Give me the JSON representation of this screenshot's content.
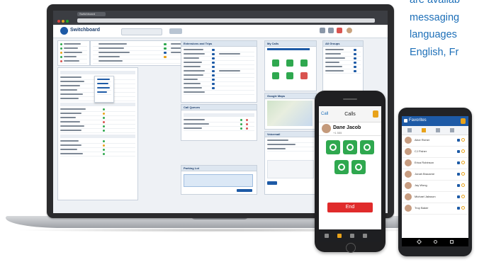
{
  "side_text": {
    "lines": [
      "are availab",
      "messaging",
      "languages",
      "English, Fr"
    ]
  },
  "laptop": {
    "browser_tab": "Switchboard",
    "app_title": "Switchboard",
    "panels": {
      "left_top": "",
      "middle_top": "Extensions and Trips",
      "middle_lower": "Call Queues",
      "middle_bottom": "Parking Lot",
      "right_top": "My Calls",
      "right_middle": "Google Maps",
      "right_lower": "Voicemail",
      "far_right": "All Groups"
    }
  },
  "ios_phone": {
    "back": "Call",
    "title": "Calls",
    "caller_name": "Dane Jacob",
    "caller_sub": "+1 555",
    "end_label": "End"
  },
  "android_phone": {
    "title": "Favorites",
    "contacts": [
      "Alice Richer",
      "CJ Fisher",
      "Erica Robinson",
      "Jonah Bracarne",
      "Jay Wong",
      "Michael Jaksson",
      "Troy Baker"
    ]
  },
  "colors": {
    "accent": "#1d6fb8",
    "brand": "#1d5aa6",
    "call_green": "#2fa84f",
    "end_red": "#e02b2b"
  }
}
